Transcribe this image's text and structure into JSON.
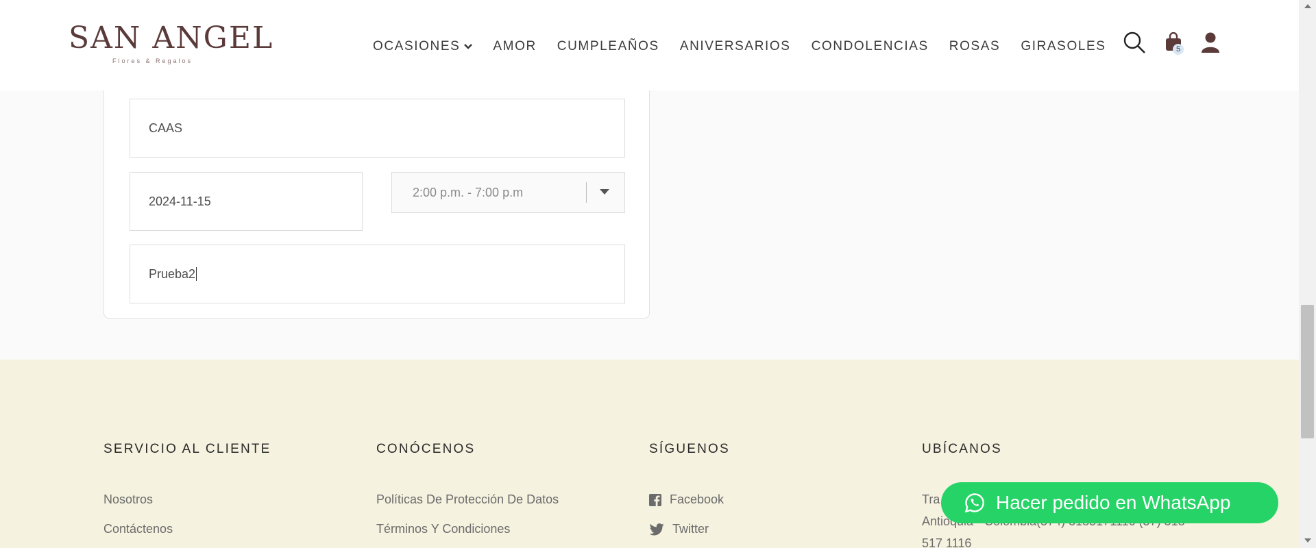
{
  "header": {
    "logo": {
      "title": "SAN ANGEL",
      "subtitle": "Flores & Regalos"
    },
    "nav": [
      {
        "label": "OCASIONES"
      },
      {
        "label": "AMOR"
      },
      {
        "label": "CUMPLEAÑOS"
      },
      {
        "label": "ANIVERSARIOS"
      },
      {
        "label": "CONDOLENCIAS"
      },
      {
        "label": "ROSAS"
      },
      {
        "label": "GIRASOLES"
      }
    ],
    "icons": {
      "search": "search-icon",
      "cart": "shopping-bag-icon",
      "account": "user-icon"
    },
    "cart_count": "5"
  },
  "form": {
    "field1_value": "CAAS",
    "date_value": "2024-11-15",
    "time_selected": "2:00 p.m. - 7:00 p.m",
    "message_value": "Prueba2"
  },
  "footer": {
    "columns": [
      {
        "title": "SERVICIO AL CLIENTE",
        "links": [
          "Nosotros",
          "Contáctenos"
        ]
      },
      {
        "title": "CONÓCENOS",
        "links": [
          "Políticas De Protección De Datos",
          "Términos Y Condiciones"
        ]
      },
      {
        "title": "SÍGUENOS",
        "links": [
          "Facebook",
          "Twitter"
        ]
      },
      {
        "title": "UBÍCANOS",
        "address_line1": "Tra",
        "address_line2": "Antioquia - Colombia(574) 3185171116 (57) 318",
        "address_line3": "517 1116"
      }
    ]
  },
  "whatsapp": {
    "label": "Hacer pedido en WhatsApp",
    "icon": "whatsapp-icon"
  },
  "colors": {
    "accent_green": "#25d366",
    "footer_bg": "#f5f2df",
    "logo": "#5b3a3a"
  }
}
